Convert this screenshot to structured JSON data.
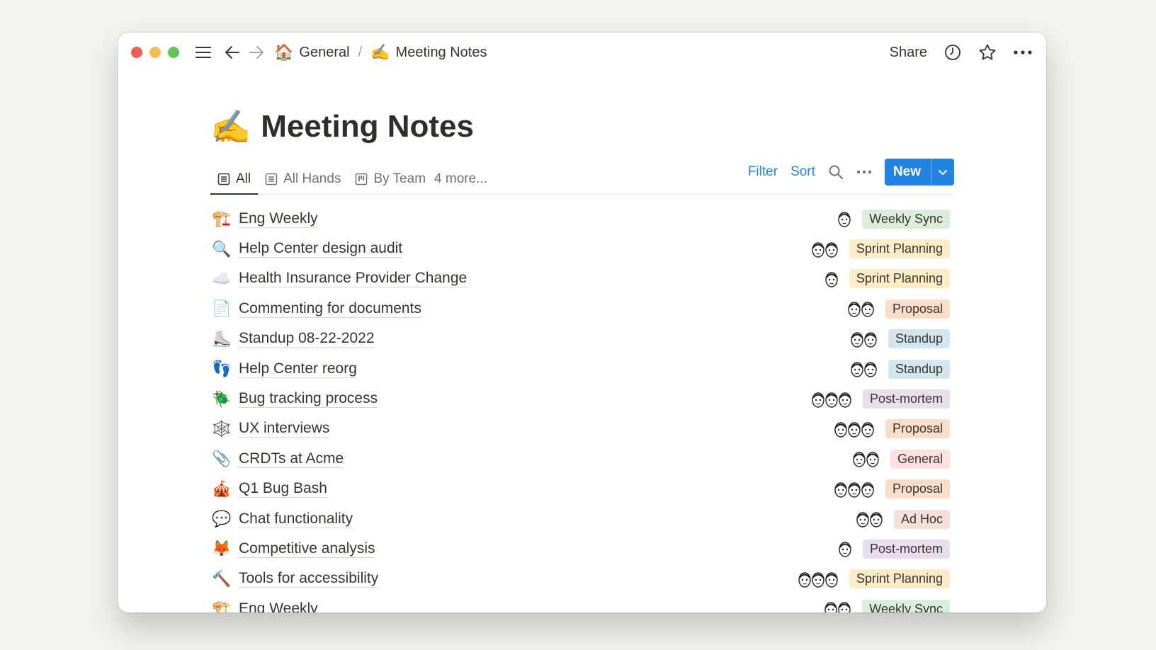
{
  "window": {
    "traffic_colors": [
      "#ee5f57",
      "#f5bd4f",
      "#61c454"
    ]
  },
  "breadcrumb": {
    "items": [
      {
        "emoji": "🏠",
        "label": "General"
      },
      {
        "emoji": "✍️",
        "label": "Meeting Notes"
      }
    ],
    "separator": "/"
  },
  "topbar": {
    "share_label": "Share"
  },
  "page": {
    "emoji": "✍️",
    "title": "Meeting Notes"
  },
  "views": {
    "tabs": [
      {
        "label": "All",
        "icon": "table-icon",
        "active": true
      },
      {
        "label": "All Hands",
        "icon": "table-icon",
        "active": false
      },
      {
        "label": "By Team",
        "icon": "board-icon",
        "active": false
      }
    ],
    "more_label": "4 more...",
    "filter_label": "Filter",
    "sort_label": "Sort",
    "new_label": "New"
  },
  "tag_colors": {
    "Weekly Sync": "#dbeddb",
    "Sprint Planning": "#fdecc8",
    "Proposal": "#fadec9",
    "Standup": "#d3e5ef",
    "Post-mortem": "#e8deee",
    "General": "#ffe2dd",
    "Ad Hoc": "#f4dfdb"
  },
  "rows": [
    {
      "emoji": "🏗️",
      "title": "Eng Weekly",
      "avatars": 1,
      "tag": "Weekly Sync"
    },
    {
      "emoji": "🔍",
      "title": "Help Center design audit",
      "avatars": 2,
      "tag": "Sprint Planning"
    },
    {
      "emoji": "☁️",
      "title": "Health Insurance Provider Change",
      "avatars": 1,
      "tag": "Sprint Planning"
    },
    {
      "emoji": "📄",
      "title": "Commenting for documents",
      "avatars": 2,
      "tag": "Proposal"
    },
    {
      "emoji": "⛸️",
      "title": "Standup 08-22-2022",
      "avatars": 2,
      "tag": "Standup"
    },
    {
      "emoji": "👣",
      "title": "Help Center reorg",
      "avatars": 2,
      "tag": "Standup"
    },
    {
      "emoji": "🪲",
      "title": "Bug tracking process",
      "avatars": 3,
      "tag": "Post-mortem"
    },
    {
      "emoji": "🕸️",
      "title": "UX interviews",
      "avatars": 3,
      "tag": "Proposal"
    },
    {
      "emoji": "📎",
      "title": "CRDTs at Acme",
      "avatars": 2,
      "tag": "General"
    },
    {
      "emoji": "🎪",
      "title": "Q1 Bug Bash",
      "avatars": 3,
      "tag": "Proposal"
    },
    {
      "emoji": "💬",
      "title": "Chat functionality",
      "avatars": 2,
      "tag": "Ad Hoc"
    },
    {
      "emoji": "🦊",
      "title": "Competitive analysis",
      "avatars": 1,
      "tag": "Post-mortem"
    },
    {
      "emoji": "🔨",
      "title": "Tools for accessibility",
      "avatars": 3,
      "tag": "Sprint Planning"
    },
    {
      "emoji": "🏗️",
      "title": "Eng Weekly",
      "avatars": 2,
      "tag": "Weekly Sync"
    }
  ]
}
